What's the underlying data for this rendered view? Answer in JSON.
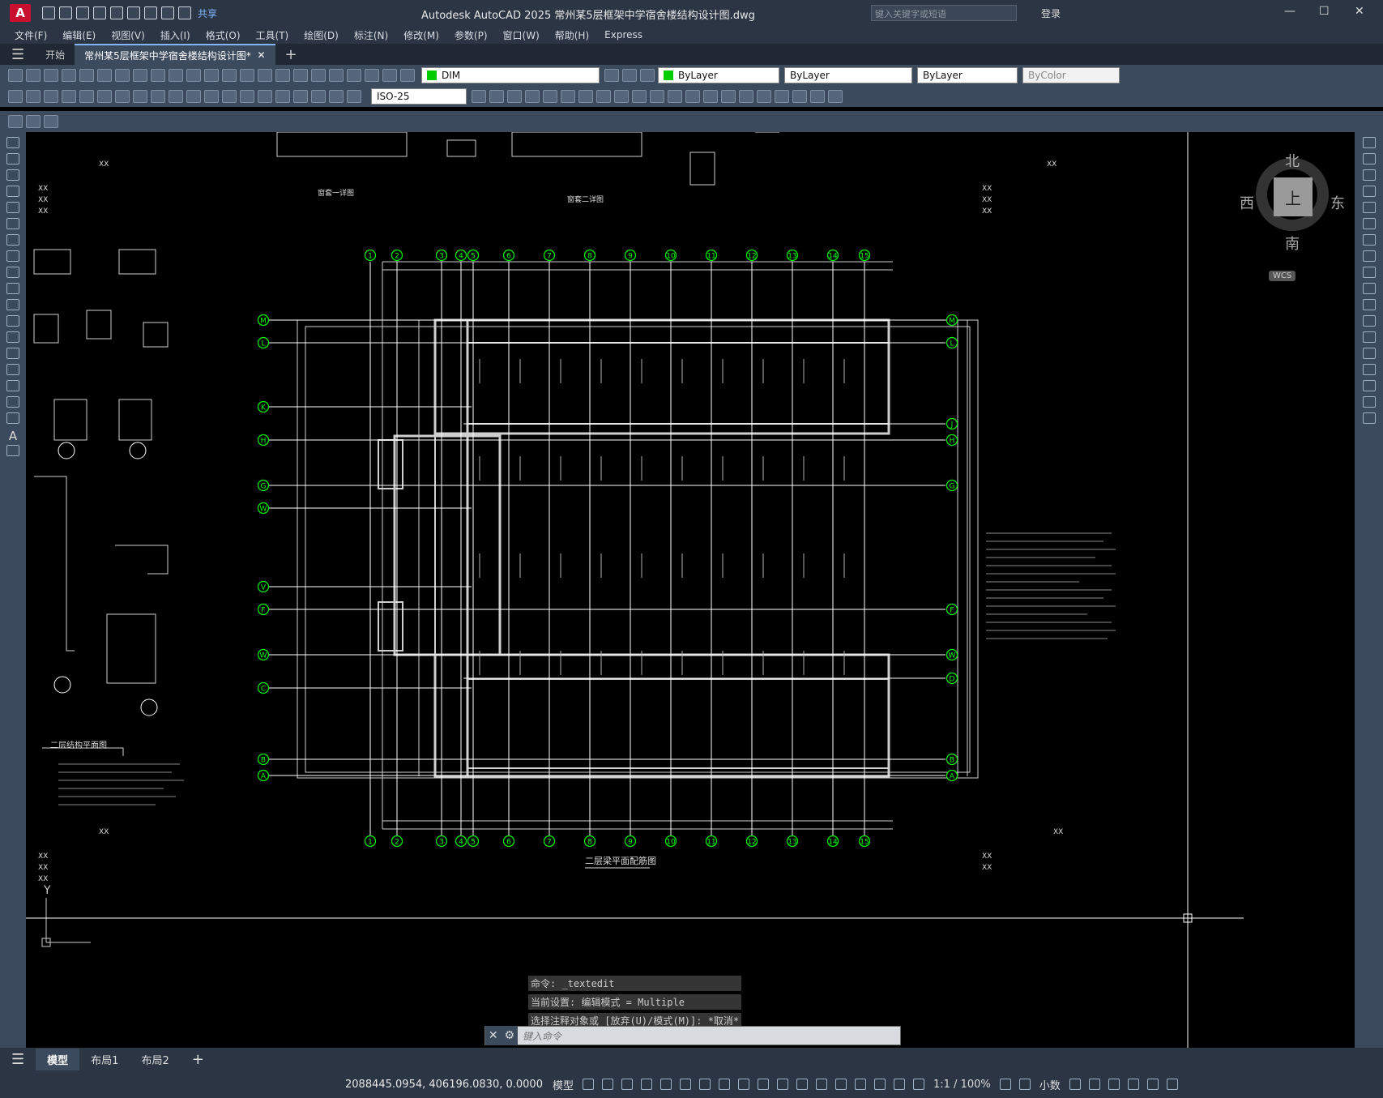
{
  "app": {
    "logo": "A",
    "title": "Autodesk AutoCAD 2025    常州某5层框架中学宿舍楼结构设计图.dwg",
    "search_placeholder": "键入关键字或短语",
    "login": "登录",
    "share": "共享"
  },
  "menu": [
    "文件(F)",
    "编辑(E)",
    "视图(V)",
    "插入(I)",
    "格式(O)",
    "工具(T)",
    "绘图(D)",
    "标注(N)",
    "修改(M)",
    "参数(P)",
    "窗口(W)",
    "帮助(H)",
    "Express"
  ],
  "doc_tabs": {
    "start": "开始",
    "file": "常州某5层框架中学宿舍楼结构设计图*"
  },
  "props": {
    "layer": "DIM",
    "color": "ByLayer",
    "linetype": "ByLayer",
    "lineweight": "ByLayer",
    "plotstyle": "ByColor",
    "dimstyle": "ISO-25"
  },
  "viewcube": {
    "north": "北",
    "south": "南",
    "east": "东",
    "west": "西",
    "top": "上",
    "wcs": "WCS"
  },
  "drawing": {
    "title_right": "二层梁平面配筋图",
    "title_left": "二层结构平面图",
    "detail1": "窗套一详图",
    "detail2": "窗套二详图",
    "col_axes": [
      "1",
      "2",
      "3",
      "4",
      "5",
      "6",
      "7",
      "8",
      "9",
      "10",
      "11",
      "12",
      "13",
      "14",
      "15"
    ],
    "row_axes": [
      "M",
      "L",
      "K",
      "H",
      "G",
      "W",
      "V",
      "F",
      "W",
      "C",
      "B",
      "A"
    ],
    "row_axes_right": [
      "M",
      "L",
      "J",
      "H",
      "G",
      "F",
      "W",
      "D",
      "B",
      "A"
    ],
    "label_xx": "XX",
    "y_label": "Y"
  },
  "command": {
    "hist1": "命令: _textedit",
    "hist2": "当前设置: 编辑模式 = Multiple",
    "hist3": "选择注释对象或 [放弃(U)/模式(M)]: *取消*",
    "placeholder": "键入命令"
  },
  "layout_tabs": [
    "模型",
    "布局1",
    "布局2"
  ],
  "status": {
    "coords": "2088445.0954, 406196.0830, 0.0000",
    "model": "模型",
    "scale": "1:1 / 100%",
    "units": "小数"
  }
}
